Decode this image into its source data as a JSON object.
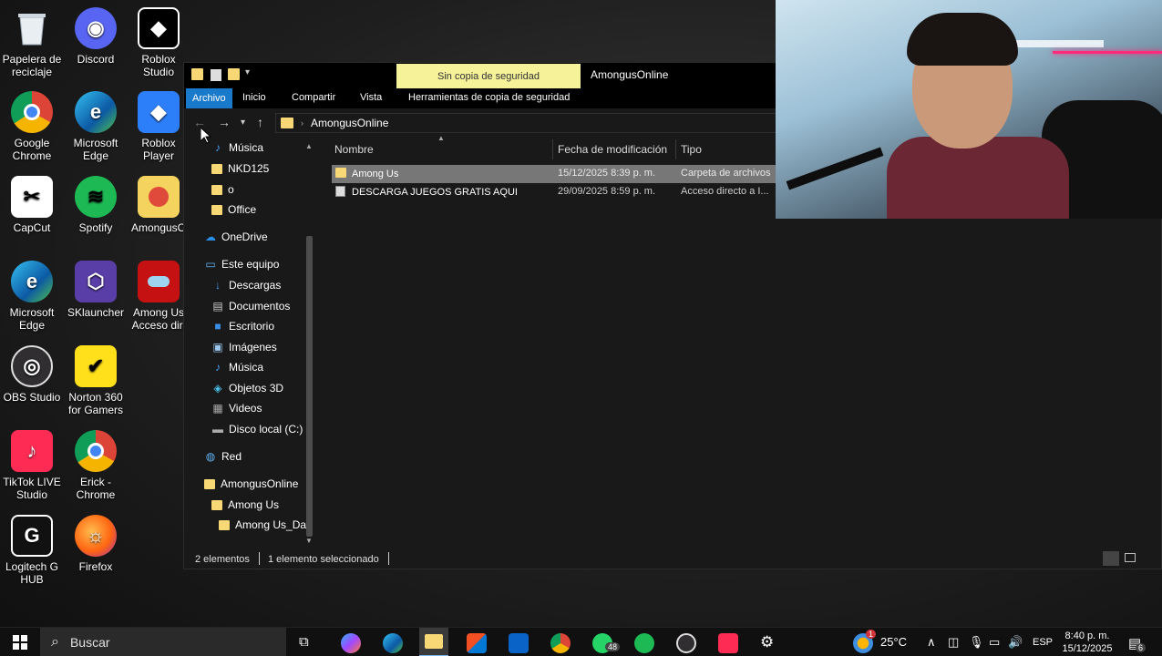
{
  "desktop": {
    "icons": [
      {
        "label": "Papelera de reciclaje",
        "icon": "recycle-bin-icon"
      },
      {
        "label": "Discord",
        "icon": "discord-icon"
      },
      {
        "label": "Roblox Studio",
        "icon": "roblox-studio-icon"
      },
      {
        "label": "Google Chrome",
        "icon": "chrome-icon"
      },
      {
        "label": "Microsoft Edge",
        "icon": "edge-icon"
      },
      {
        "label": "Roblox Player",
        "icon": "roblox-player-icon"
      },
      {
        "label": "CapCut",
        "icon": "capcut-icon"
      },
      {
        "label": "Spotify",
        "icon": "spotify-icon"
      },
      {
        "label": "AmongusO",
        "icon": "amongusonline-icon"
      },
      {
        "label": "Microsoft Edge",
        "icon": "edge-icon"
      },
      {
        "label": "SKlauncher",
        "icon": "sklauncher-icon"
      },
      {
        "label": "Among Us Acceso dir.",
        "icon": "among-us-icon"
      },
      {
        "label": "OBS Studio",
        "icon": "obs-icon"
      },
      {
        "label": "Norton 360 for Gamers",
        "icon": "norton-icon"
      },
      {
        "label": "TikTok LIVE Studio",
        "icon": "tiktok-icon"
      },
      {
        "label": "Erick - Chrome",
        "icon": "chrome-profile-icon"
      },
      {
        "label": "Logitech G HUB",
        "icon": "logitech-icon"
      },
      {
        "label": "Firefox",
        "icon": "firefox-icon"
      }
    ]
  },
  "explorer": {
    "title": "AmongusOnline",
    "backup_banner": "Sin copia de seguridad",
    "ribbon_tabs": [
      "Archivo",
      "Inicio",
      "Compartir",
      "Vista",
      "Herramientas de copia de seguridad"
    ],
    "address_path": "AmongusOnline",
    "nav_items": [
      {
        "label": "Música",
        "icon": "music-icon"
      },
      {
        "label": "NKD125",
        "icon": "folder-icon"
      },
      {
        "label": "o",
        "icon": "folder-icon"
      },
      {
        "label": "Office",
        "icon": "folder-icon"
      },
      {
        "label": "OneDrive",
        "icon": "onedrive-icon"
      },
      {
        "label": "Este equipo",
        "icon": "this-pc-icon"
      },
      {
        "label": "Descargas",
        "icon": "downloads-icon"
      },
      {
        "label": "Documentos",
        "icon": "documents-icon"
      },
      {
        "label": "Escritorio",
        "icon": "desktop-icon"
      },
      {
        "label": "Imágenes",
        "icon": "pictures-icon"
      },
      {
        "label": "Música",
        "icon": "music-icon"
      },
      {
        "label": "Objetos 3D",
        "icon": "objects3d-icon"
      },
      {
        "label": "Videos",
        "icon": "videos-icon"
      },
      {
        "label": "Disco local (C:)",
        "icon": "drive-icon"
      },
      {
        "label": "Red",
        "icon": "network-icon"
      },
      {
        "label": "AmongusOnline",
        "icon": "folder-icon"
      },
      {
        "label": "Among Us",
        "icon": "folder-icon"
      },
      {
        "label": "Among Us_Dat",
        "icon": "folder-icon"
      }
    ],
    "columns": [
      "Nombre",
      "Fecha de modificación",
      "Tipo"
    ],
    "files": [
      {
        "name": "Among Us",
        "date": "15/12/2025 8:39 p. m.",
        "type": "Carpeta de archivos",
        "icon": "folder-icon"
      },
      {
        "name": "DESCARGA JUEGOS GRATIS AQUI",
        "date": "29/09/2025 8:59 p. m.",
        "type": "Acceso directo a I...",
        "icon": "shortcut-icon"
      }
    ],
    "status": {
      "count": "2 elementos",
      "selected": "1 elemento seleccionado"
    }
  },
  "taskbar": {
    "search_placeholder": "Buscar",
    "weather": "25°C",
    "weather_badge": "1",
    "whatsapp_badge": "48",
    "language": "ESP",
    "time": "8:40 p. m.",
    "date": "15/12/2025",
    "notifications": "6"
  }
}
